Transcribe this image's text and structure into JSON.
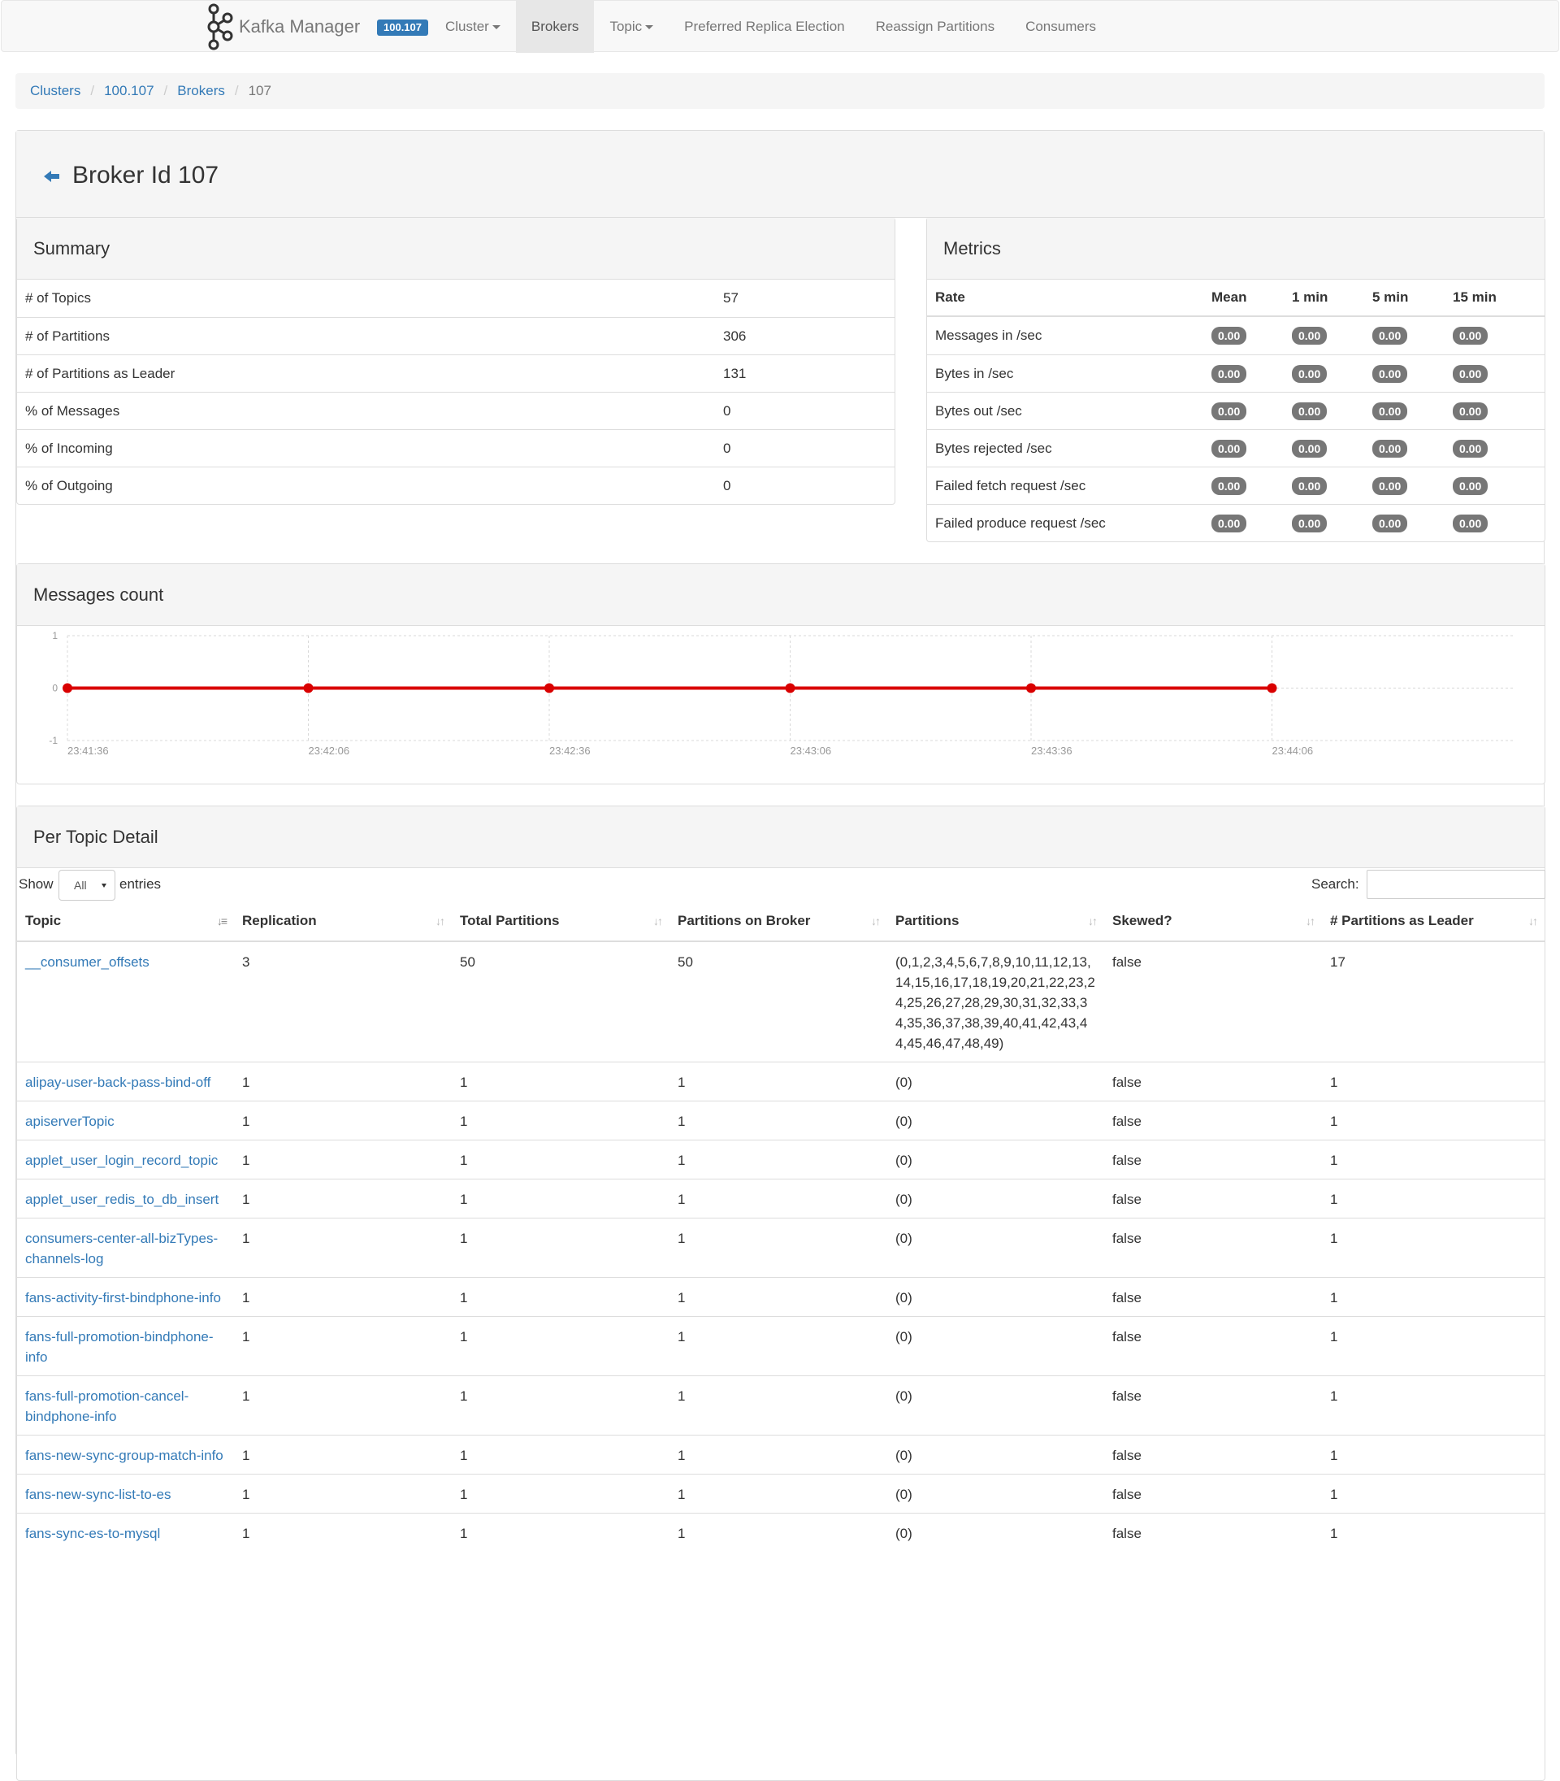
{
  "navbar": {
    "brand": "Kafka Manager",
    "cluster_badge": "100.107",
    "items": [
      {
        "label": "Cluster",
        "dropdown": true,
        "active": false
      },
      {
        "label": "Brokers",
        "dropdown": false,
        "active": true
      },
      {
        "label": "Topic",
        "dropdown": true,
        "active": false
      },
      {
        "label": "Preferred Replica Election",
        "dropdown": false,
        "active": false
      },
      {
        "label": "Reassign Partitions",
        "dropdown": false,
        "active": false
      },
      {
        "label": "Consumers",
        "dropdown": false,
        "active": false
      }
    ]
  },
  "breadcrumb": [
    "Clusters",
    "100.107",
    "Brokers",
    "107"
  ],
  "page_title": "Broker Id 107",
  "summary": {
    "title": "Summary",
    "rows": [
      {
        "label": "# of Topics",
        "value": "57"
      },
      {
        "label": "# of Partitions",
        "value": "306"
      },
      {
        "label": "# of Partitions as Leader",
        "value": "131"
      },
      {
        "label": "% of Messages",
        "value": "0"
      },
      {
        "label": "% of Incoming",
        "value": "0"
      },
      {
        "label": "% of Outgoing",
        "value": "0"
      }
    ]
  },
  "metrics": {
    "title": "Metrics",
    "headers": [
      "Rate",
      "Mean",
      "1 min",
      "5 min",
      "15 min"
    ],
    "rows": [
      {
        "rate": "Messages in /sec",
        "values": [
          "0.00",
          "0.00",
          "0.00",
          "0.00"
        ]
      },
      {
        "rate": "Bytes in /sec",
        "values": [
          "0.00",
          "0.00",
          "0.00",
          "0.00"
        ]
      },
      {
        "rate": "Bytes out /sec",
        "values": [
          "0.00",
          "0.00",
          "0.00",
          "0.00"
        ]
      },
      {
        "rate": "Bytes rejected /sec",
        "values": [
          "0.00",
          "0.00",
          "0.00",
          "0.00"
        ]
      },
      {
        "rate": "Failed fetch request /sec",
        "values": [
          "0.00",
          "0.00",
          "0.00",
          "0.00"
        ]
      },
      {
        "rate": "Failed produce request /sec",
        "values": [
          "0.00",
          "0.00",
          "0.00",
          "0.00"
        ]
      }
    ]
  },
  "messages_count_title": "Messages count",
  "chart_data": {
    "type": "line",
    "title": "Messages count",
    "x": [
      "23:41:36",
      "23:42:06",
      "23:42:36",
      "23:43:06",
      "23:43:36",
      "23:44:06"
    ],
    "series": [
      {
        "values": [
          0,
          0,
          0,
          0,
          0,
          0
        ],
        "color": "#d90000"
      }
    ],
    "ylim": [
      -1,
      1
    ],
    "yticks": [
      "1",
      "0",
      "-1"
    ],
    "grid": true
  },
  "per_topic": {
    "title": "Per Topic Detail",
    "show_label": "Show",
    "show_value": "All",
    "entries_label": "entries",
    "search_label": "Search:",
    "columns": [
      "Topic",
      "Replication",
      "Total Partitions",
      "Partitions on Broker",
      "Partitions",
      "Skewed?",
      "# Partitions as Leader"
    ],
    "rows": [
      {
        "topic": "__consumer_offsets",
        "replication": "3",
        "total": "50",
        "on_broker": "50",
        "partitions": "(0,1,2,3,4,5,6,7,8,9,10,11,12,13,14,15,16,17,18,19,20,21,22,23,24,25,26,27,28,29,30,31,32,33,34,35,36,37,38,39,40,41,42,43,44,45,46,47,48,49)",
        "skewed": "false",
        "leader": "17"
      },
      {
        "topic": "alipay-user-back-pass-bind-off",
        "replication": "1",
        "total": "1",
        "on_broker": "1",
        "partitions": "(0)",
        "skewed": "false",
        "leader": "1"
      },
      {
        "topic": "apiserverTopic",
        "replication": "1",
        "total": "1",
        "on_broker": "1",
        "partitions": "(0)",
        "skewed": "false",
        "leader": "1"
      },
      {
        "topic": "applet_user_login_record_topic",
        "replication": "1",
        "total": "1",
        "on_broker": "1",
        "partitions": "(0)",
        "skewed": "false",
        "leader": "1"
      },
      {
        "topic": "applet_user_redis_to_db_insert",
        "replication": "1",
        "total": "1",
        "on_broker": "1",
        "partitions": "(0)",
        "skewed": "false",
        "leader": "1"
      },
      {
        "topic": "consumers-center-all-bizTypes-channels-log",
        "replication": "1",
        "total": "1",
        "on_broker": "1",
        "partitions": "(0)",
        "skewed": "false",
        "leader": "1"
      },
      {
        "topic": "fans-activity-first-bindphone-info",
        "replication": "1",
        "total": "1",
        "on_broker": "1",
        "partitions": "(0)",
        "skewed": "false",
        "leader": "1"
      },
      {
        "topic": "fans-full-promotion-bindphone-info",
        "replication": "1",
        "total": "1",
        "on_broker": "1",
        "partitions": "(0)",
        "skewed": "false",
        "leader": "1"
      },
      {
        "topic": "fans-full-promotion-cancel-bindphone-info",
        "replication": "1",
        "total": "1",
        "on_broker": "1",
        "partitions": "(0)",
        "skewed": "false",
        "leader": "1"
      },
      {
        "topic": "fans-new-sync-group-match-info",
        "replication": "1",
        "total": "1",
        "on_broker": "1",
        "partitions": "(0)",
        "skewed": "false",
        "leader": "1"
      },
      {
        "topic": "fans-new-sync-list-to-es",
        "replication": "1",
        "total": "1",
        "on_broker": "1",
        "partitions": "(0)",
        "skewed": "false",
        "leader": "1"
      },
      {
        "topic": "fans-sync-es-to-mysql",
        "replication": "1",
        "total": "1",
        "on_broker": "1",
        "partitions": "(0)",
        "skewed": "false",
        "leader": "1"
      }
    ]
  },
  "colors": {
    "link": "#337ab7",
    "series": "#d90000",
    "badge": "#777777",
    "cluster_badge": "#337ab7"
  }
}
